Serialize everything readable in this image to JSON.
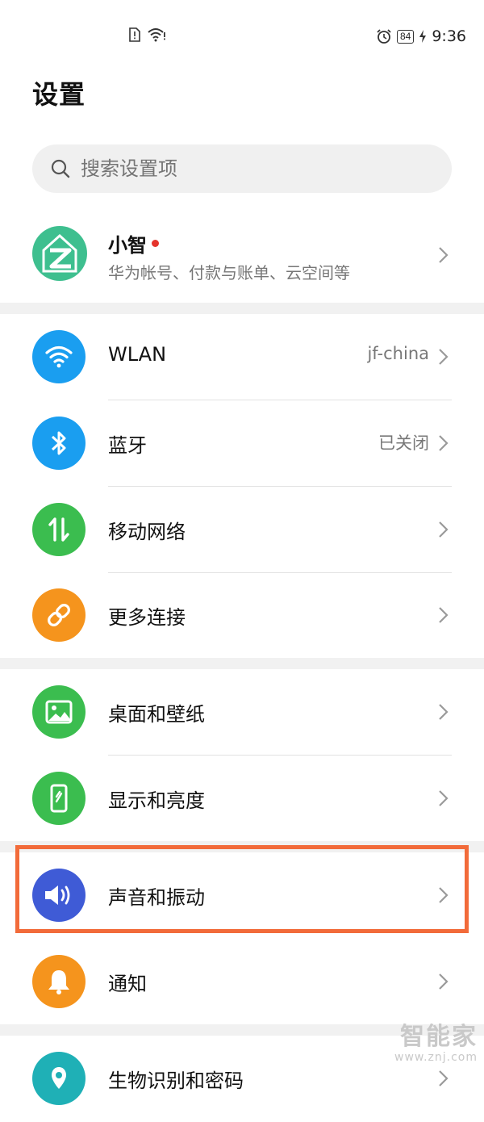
{
  "statusbar": {
    "battery": "84",
    "time": "9:36"
  },
  "page": {
    "title": "设置"
  },
  "search": {
    "placeholder": "搜索设置项"
  },
  "account": {
    "name": "小智",
    "subtitle": "华为帐号、付款与账单、云空间等"
  },
  "sections": [
    {
      "items": [
        {
          "label": "WLAN",
          "value": "jf-china",
          "icon": "wifi-icon",
          "color": "#1a9ef0"
        },
        {
          "label": "蓝牙",
          "value": "已关闭",
          "icon": "bluetooth-icon",
          "color": "#1a9ef0"
        },
        {
          "label": "移动网络",
          "value": "",
          "icon": "mobile-data-icon",
          "color": "#3bbd4f"
        },
        {
          "label": "更多连接",
          "value": "",
          "icon": "link-icon",
          "color": "#f5941d"
        }
      ]
    },
    {
      "items": [
        {
          "label": "桌面和壁纸",
          "value": "",
          "icon": "wallpaper-icon",
          "color": "#3bbd4f"
        },
        {
          "label": "显示和亮度",
          "value": "",
          "icon": "display-icon",
          "color": "#3bbd4f"
        }
      ]
    },
    {
      "items": [
        {
          "label": "声音和振动",
          "value": "",
          "icon": "sound-icon",
          "color": "#3f5bd6",
          "highlighted": true
        },
        {
          "label": "通知",
          "value": "",
          "icon": "bell-icon",
          "color": "#f5941d"
        }
      ]
    },
    {
      "items": [
        {
          "label": "生物识别和密码",
          "value": "",
          "icon": "fingerprint-icon",
          "color": "#1fb0b6"
        }
      ]
    }
  ],
  "highlight_color": "#f26b3a",
  "watermark": {
    "brand": "智能家",
    "url": "www.znj.com"
  }
}
